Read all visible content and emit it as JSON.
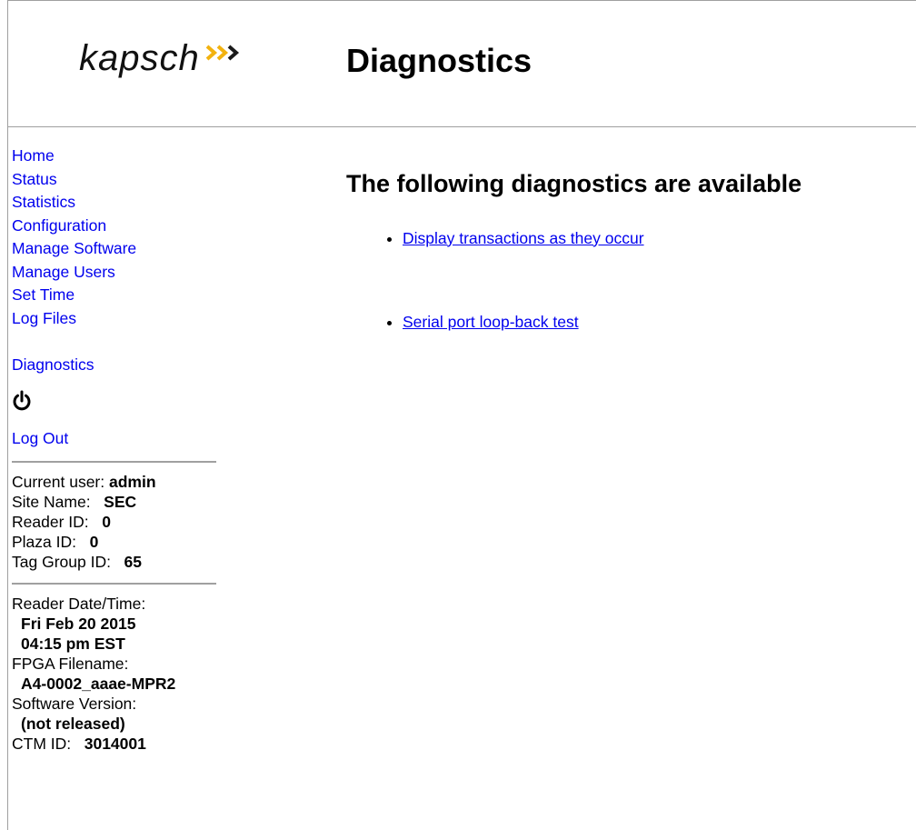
{
  "brand": {
    "name": "kapsch",
    "chevron_colors": [
      "#f2b20f",
      "#f2b20f",
      "#1a1a1a"
    ]
  },
  "header": {
    "title": "Diagnostics"
  },
  "sidebar": {
    "nav": [
      "Home",
      "Status",
      "Statistics",
      "Configuration",
      "Manage Software",
      "Manage Users",
      "Set Time",
      "Log Files"
    ],
    "diagnostics_link": "Diagnostics",
    "power_icon": "power-icon",
    "logout": "Log Out",
    "session": {
      "current_user_label": "Current user:",
      "current_user": "admin",
      "site_name_label": "Site Name:",
      "site_name": "SEC",
      "reader_id_label": "Reader ID:",
      "reader_id": "0",
      "plaza_id_label": "Plaza ID:",
      "plaza_id": "0",
      "tag_group_id_label": "Tag Group ID:",
      "tag_group_id": "65"
    },
    "system": {
      "reader_datetime_label": "Reader Date/Time:",
      "reader_date": "Fri Feb 20 2015",
      "reader_time": "04:15 pm EST",
      "fpga_filename_label": "FPGA Filename:",
      "fpga_filename": "A4-0002_aaae-MPR2",
      "software_version_label": "Software Version:",
      "software_version": "(not released)",
      "ctm_id_label": "CTM ID:",
      "ctm_id": "3014001"
    }
  },
  "main": {
    "heading": "The following diagnostics are available",
    "items": [
      "Display transactions as they occur",
      "Serial port loop-back test"
    ]
  },
  "colors": {
    "link": "#0000ee",
    "rule": "#a0a0a0",
    "accent": "#f2b20f"
  }
}
